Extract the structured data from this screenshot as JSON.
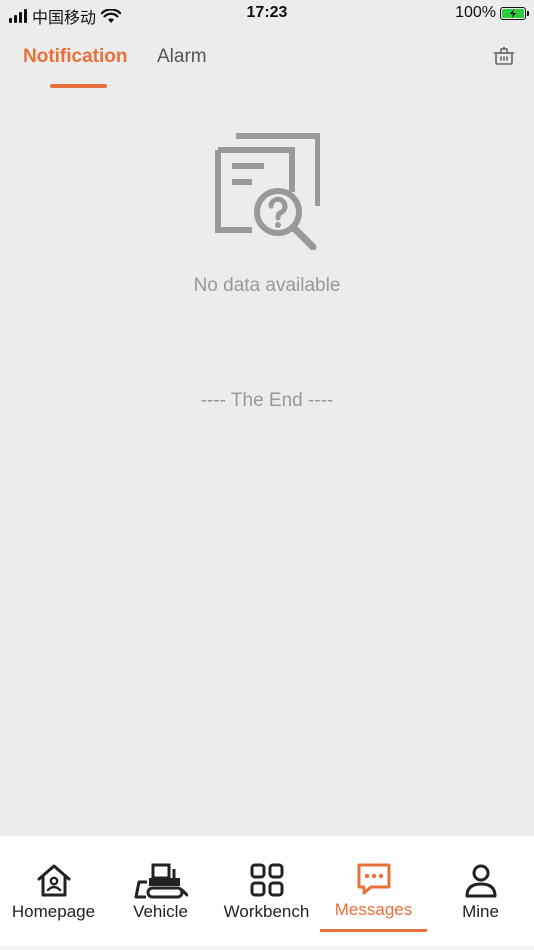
{
  "status_bar": {
    "carrier": "中国移动",
    "time": "17:23",
    "battery": "100%"
  },
  "tabs": [
    {
      "label": "Notification",
      "active": true
    },
    {
      "label": "Alarm",
      "active": false
    }
  ],
  "header": {
    "clear_icon": "trash-icon"
  },
  "main": {
    "empty_icon": "no-data-search-icon",
    "empty_text": "No data available",
    "end_text": "---- The End ----"
  },
  "bottom_nav": {
    "items": [
      {
        "label": "Homepage",
        "icon": "home-icon",
        "active": false
      },
      {
        "label": "Vehicle",
        "icon": "bulldozer-icon",
        "active": false
      },
      {
        "label": "Workbench",
        "icon": "grid-icon",
        "active": false
      },
      {
        "label": "Messages",
        "icon": "chat-bubble-icon",
        "active": true
      },
      {
        "label": "Mine",
        "icon": "user-icon",
        "active": false
      }
    ]
  },
  "colors": {
    "accent": "#e8703a",
    "background": "#ececec",
    "muted_text": "#999999",
    "battery_fill": "#2ecc40"
  }
}
